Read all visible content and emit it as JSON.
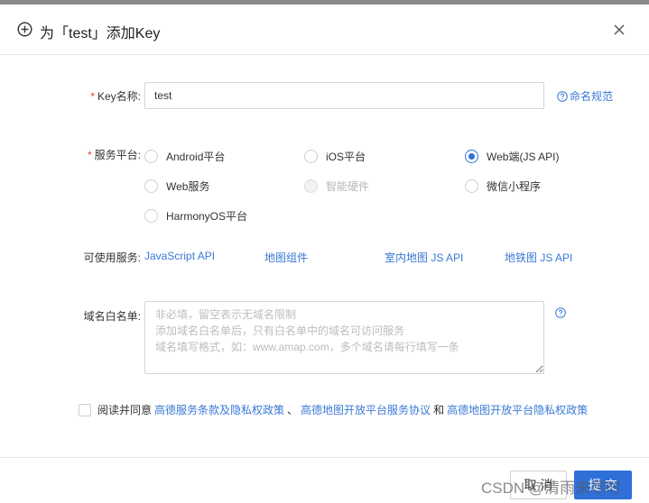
{
  "dialog": {
    "title": "为「test」添加Key",
    "icons": {
      "title": "plus-circle-icon",
      "close": "close-icon"
    }
  },
  "form": {
    "key_name": {
      "required_mark": "*",
      "label": "Key名称:",
      "value": "test",
      "help_text": "命名规范"
    },
    "platform": {
      "required_mark": "*",
      "label": "服务平台:",
      "options": [
        {
          "label": "Android平台",
          "checked": false,
          "disabled": false
        },
        {
          "label": "iOS平台",
          "checked": false,
          "disabled": false
        },
        {
          "label": "Web端(JS API)",
          "checked": true,
          "disabled": false
        },
        {
          "label": "Web服务",
          "checked": false,
          "disabled": false
        },
        {
          "label": "智能硬件",
          "checked": false,
          "disabled": true
        },
        {
          "label": "微信小程序",
          "checked": false,
          "disabled": false
        },
        {
          "label": "HarmonyOS平台",
          "checked": false,
          "disabled": false
        }
      ]
    },
    "services": {
      "label": "可使用服务:",
      "items": [
        "JavaScript API",
        "地图组件",
        "室内地图 JS API",
        "地铁图 JS API"
      ]
    },
    "whitelist": {
      "label": "域名白名单:",
      "placeholder": "非必填，留空表示无域名限制\n添加域名白名单后，只有白名单中的域名可访问服务\n域名填写格式，如：www.amap.com，多个域名请每行填写一条"
    },
    "agreement": {
      "prefix": "阅读并同意",
      "link1": "高德服务条款及隐私权政策",
      "sep1": "、",
      "link2": "高德地图开放平台服务协议",
      "sep2": "和",
      "link3": "高德地图开放平台隐私权政策",
      "checked": false
    }
  },
  "footer": {
    "cancel_label": "取 消",
    "submit_label": "提 交"
  },
  "watermark": "CSDN @清雨未尽时",
  "colors": {
    "accent": "#2f6fd8",
    "link": "#3a79d6",
    "required": "#e0453a"
  }
}
